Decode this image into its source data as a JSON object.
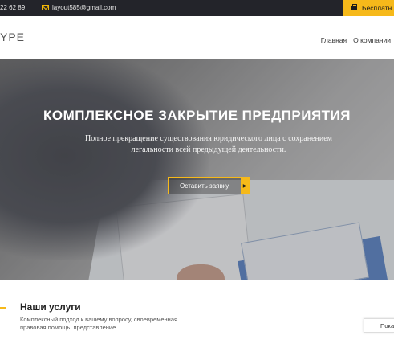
{
  "topbar": {
    "phone": "22 62 89",
    "email": "layout585@gmail.com",
    "cta_label": "Бесплатн"
  },
  "header": {
    "logo": "YPE",
    "nav": [
      "Главная",
      "О компании"
    ]
  },
  "hero": {
    "title": "КОМПЛЕКСНОЕ ЗАКРЫТИЕ ПРЕДПРИЯТИЯ",
    "subtitle": "Полное прекращение существования юридического лица с сохранением легальности всей предыдущей деятельности.",
    "button_label": "Оставить заявку"
  },
  "services": {
    "title": "Наши услуги",
    "description": "Комплексный подход к вашему вопросу, своевременная правовая помощь, представление",
    "side_button": "Пока"
  },
  "colors": {
    "accent": "#f6b91a",
    "topbar_bg": "#23242a"
  }
}
